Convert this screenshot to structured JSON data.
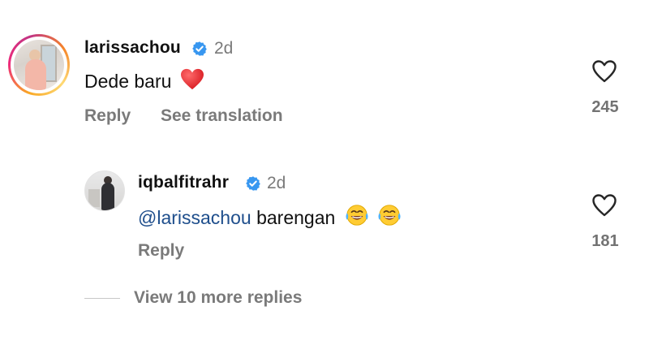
{
  "comments": [
    {
      "username": "larissachou",
      "time": "2d",
      "text": "Dede baru",
      "emoji": "red-heart",
      "reply_label": "Reply",
      "translation_label": "See translation",
      "likes": "245",
      "verified": true
    }
  ],
  "replies": [
    {
      "username": "iqbalfitrahr",
      "time": "2d",
      "mention": "@larissachou",
      "text": "barengan",
      "emoji": [
        "face-with-tears-of-joy",
        "face-with-tears-of-joy"
      ],
      "reply_label": "Reply",
      "likes": "181",
      "verified": true
    }
  ],
  "view_more_label": "View 10 more replies",
  "colors": {
    "verified_badge": "#3897f0",
    "mention": "#1e4e8c",
    "meta_text": "#7a7a7a",
    "heart_emoji": "#e0242c"
  }
}
